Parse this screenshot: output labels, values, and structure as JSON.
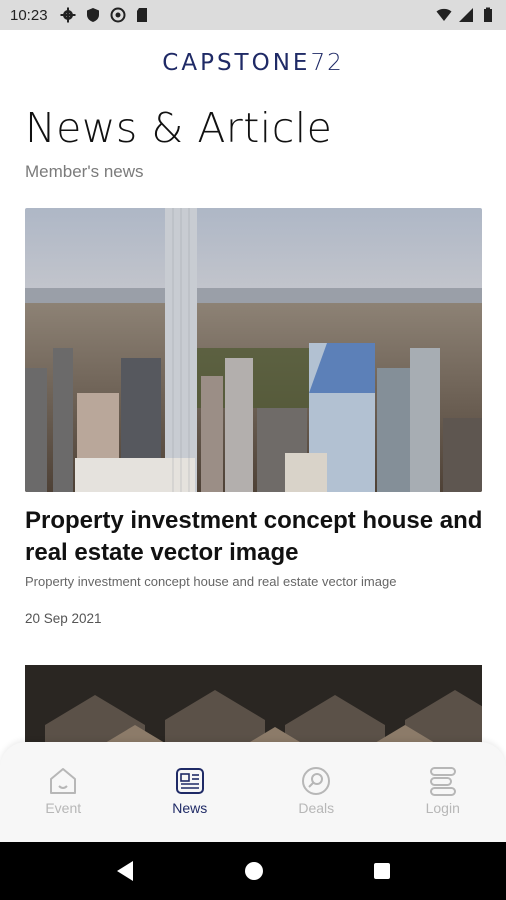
{
  "status_bar": {
    "time": "10:23"
  },
  "header": {
    "brand_main": "CAPSTONE",
    "brand_num": "72"
  },
  "page": {
    "title": "News & Article",
    "subtitle": "Member's news"
  },
  "articles": [
    {
      "title": "Property investment concept house and real estate vector image",
      "description": "Property investment concept house and real estate vector image",
      "date": "20 Sep 2021"
    }
  ],
  "bottom_nav": {
    "items": [
      {
        "label": "Event",
        "icon": "home-icon",
        "active": false
      },
      {
        "label": "News",
        "icon": "news-icon",
        "active": true
      },
      {
        "label": "Deals",
        "icon": "search-icon",
        "active": false
      },
      {
        "label": "Login",
        "icon": "login-icon",
        "active": false
      }
    ]
  },
  "colors": {
    "brand": "#1f2a66",
    "inactive": "#b7b7b7",
    "status_bar": "#dcdcdc"
  }
}
